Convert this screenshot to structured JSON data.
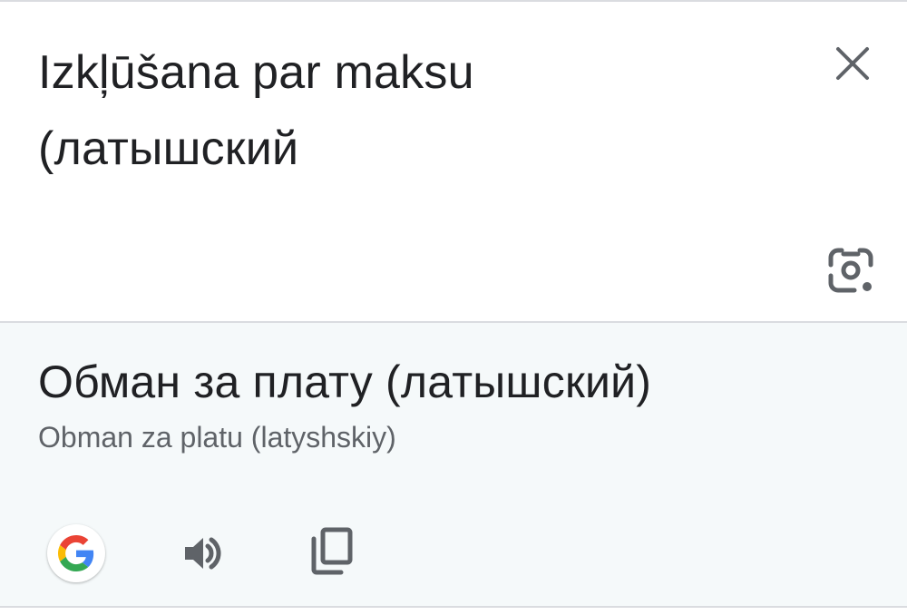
{
  "source": {
    "text_line1": "Izkļūšana par maksu",
    "text_line2": "(латышский"
  },
  "result": {
    "translation": "Обман за плату (латышский)",
    "transliteration": "Obman za platu (latyshskiy)"
  },
  "icons": {
    "close": "close-icon",
    "camera": "camera-lens-icon",
    "google": "google-logo-icon",
    "speaker": "speaker-icon",
    "copy": "copy-icon"
  },
  "colors": {
    "text_primary": "#202124",
    "text_secondary": "#5f6368",
    "icon": "#5f6368",
    "result_background": "#f5f9fa",
    "divider": "#dadce0",
    "google_blue": "#4285F4",
    "google_red": "#EA4335",
    "google_yellow": "#FBBC05",
    "google_green": "#34A853"
  }
}
